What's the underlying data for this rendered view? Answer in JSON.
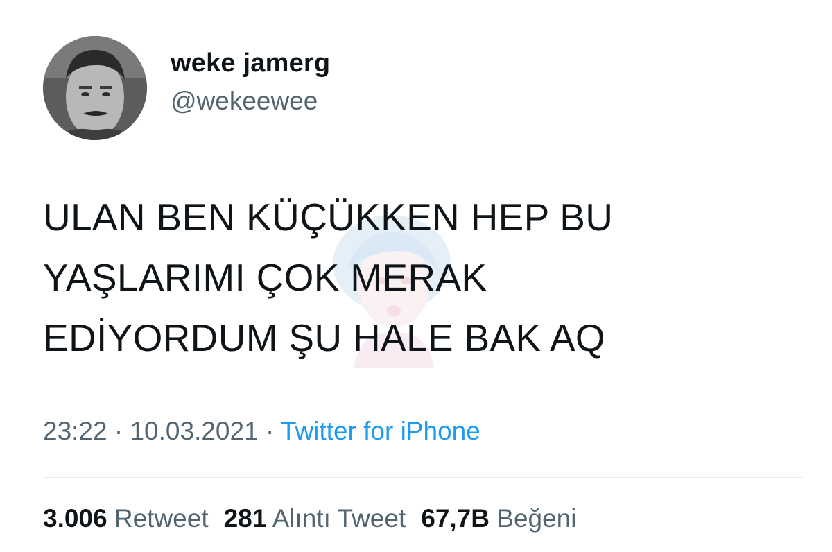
{
  "author": {
    "display_name": "weke jamerg",
    "handle": "@wekeewee"
  },
  "tweet": {
    "lines": [
      "ULAN BEN KÜÇÜKKEN HEP BU",
      "YAŞLARIMI ÇOK MERAK",
      "EDİYORDUM ŞU HALE BAK AQ"
    ],
    "time": "23:22",
    "date": "10.03.2021",
    "separator": " · ",
    "source": "Twitter for iPhone"
  },
  "stats": {
    "retweets": {
      "count": "3.006",
      "label": "Retweet"
    },
    "quotes": {
      "count": "281",
      "label": "Alıntı Tweet"
    },
    "likes": {
      "count": "67,7B",
      "label": "Beğeni"
    }
  },
  "colors": {
    "text": "#0f1419",
    "secondary": "#536471",
    "link": "#1d9bf0",
    "divider": "#e6ecf0"
  }
}
